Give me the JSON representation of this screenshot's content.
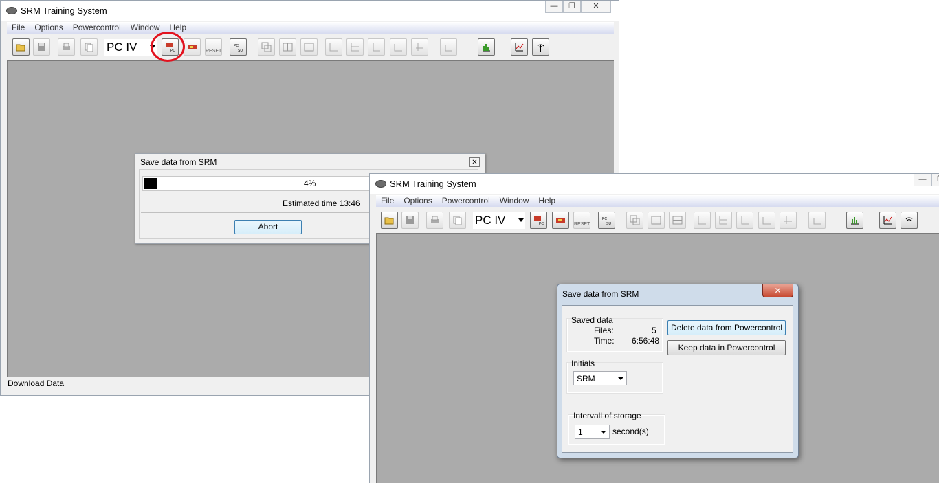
{
  "back_window": {
    "title": "SRM Training System",
    "menu": [
      "File",
      "Options",
      "Powercontrol",
      "Window",
      "Help"
    ],
    "pc_combo_value": "PC IV",
    "status_text": "Download Data",
    "dialog": {
      "title": "Save data from  SRM",
      "progress_percent": 4,
      "progress_label": "4%",
      "estimated_time": "Estimated time 13:46",
      "abort_label": "Abort"
    }
  },
  "front_window": {
    "title": "SRM Training System",
    "menu": [
      "File",
      "Options",
      "Powercontrol",
      "Window",
      "Help"
    ],
    "pc_combo_value": "PC IV",
    "dialog": {
      "title": "Save data from  SRM",
      "saved_data_label": "Saved data",
      "files_label": "Files:",
      "files_value": "5",
      "time_label": "Time:",
      "time_value": "6:56:48",
      "initials_label": "Initials",
      "initials_value": "SRM",
      "interval_label": "Intervall of storage",
      "interval_value": "1",
      "interval_unit": "second(s)",
      "delete_button": "Delete data from Powercontrol",
      "keep_button": "Keep data in Powercontrol"
    }
  },
  "toolbar_text": {
    "reset_label": "RESET",
    "pc_label": "PC",
    "su_label": "SU"
  },
  "highlight_color": "#e2121f"
}
